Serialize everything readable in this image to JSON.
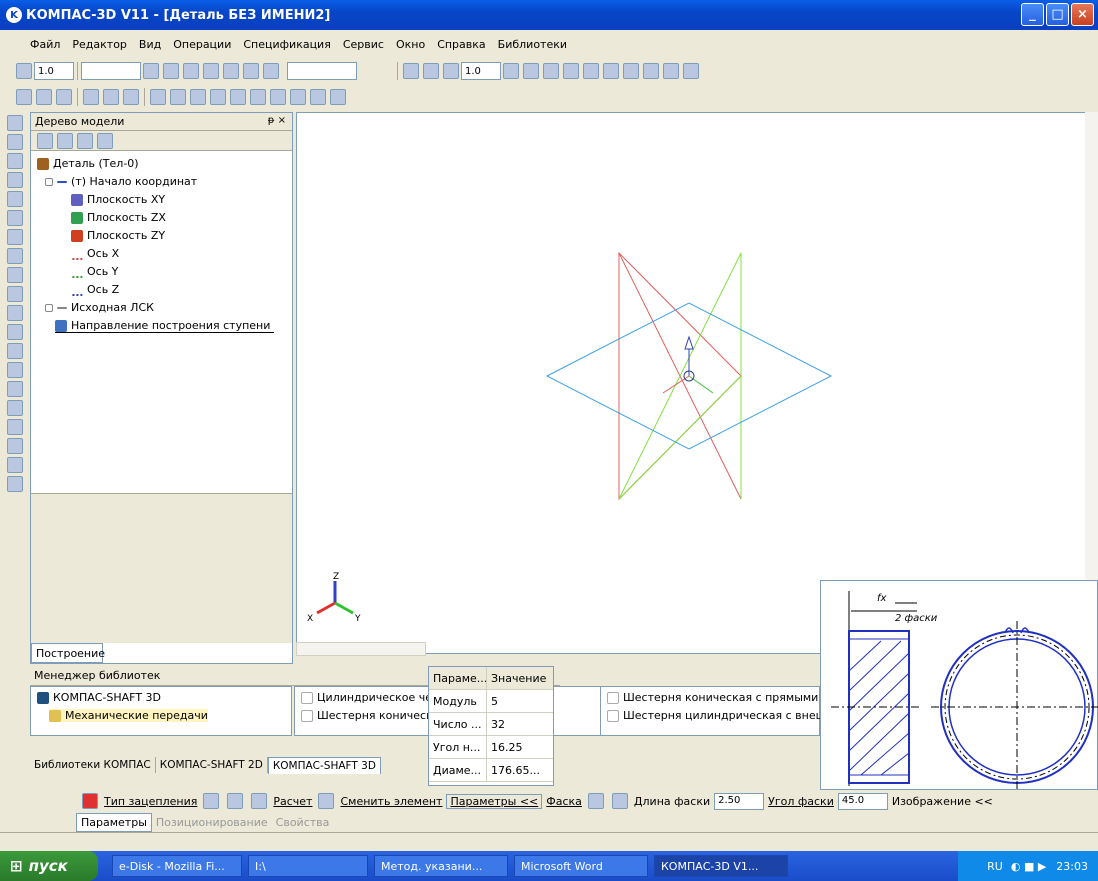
{
  "window": {
    "title": "КОМПАС-3D V11 - [Деталь БЕЗ ИМЕНИ2]"
  },
  "menu": [
    "Файл",
    "Редактор",
    "Вид",
    "Операции",
    "Спецификация",
    "Сервис",
    "Окно",
    "Справка",
    "Библиотеки"
  ],
  "toolbar": {
    "scale_left": "1.0",
    "scale_right": "1.0"
  },
  "tree": {
    "panel_title": "Дерево модели",
    "items": [
      "Деталь (Тел-0)",
      "(т) Начало координат",
      "Плоскость XY",
      "Плоскость ZX",
      "Плоскость ZY",
      "Ось X",
      "Ось Y",
      "Ось Z",
      "Исходная ЛСК",
      "Направление построения ступени"
    ],
    "tab": "Построение"
  },
  "library": {
    "title": "Менеджер библиотек",
    "list": [
      "КОМПАС-SHAFT 3D",
      "Механические передачи"
    ],
    "items_left": [
      "Цилиндрическое чер",
      "Шестерня коническа"
    ],
    "items_right": [
      "Шестерня коническая с прямыми з",
      "Шестерня цилиндрическая с внеш"
    ],
    "tabs": [
      "Библиотеки КОМПАС",
      "КОМПАС-SHAFT 2D",
      "КОМПАС-SHAFT 3D"
    ]
  },
  "params": {
    "header": [
      "Параме...",
      "Значение"
    ],
    "rows": [
      [
        "Модуль",
        "5"
      ],
      [
        "Число ...",
        "32"
      ],
      [
        "Угол н...",
        "16.25"
      ],
      [
        "Диаме...",
        "176.65..."
      ]
    ]
  },
  "preview": {
    "label_top": "fx",
    "label_bottom": "2 фаски"
  },
  "propbar": {
    "mesh": "Тип зацепления",
    "calc": "Расчет",
    "change": "Сменить элемент",
    "params": "Параметры <<",
    "chamfer": "Фаска",
    "chamfer_len_label": "Длина фаски",
    "chamfer_len": "2.50",
    "chamfer_angle_label": "Угол фаски",
    "chamfer_angle": "45.0",
    "image": "Изображение <<"
  },
  "proptabs": [
    "Параметры",
    "Позиционирование",
    "Свойства"
  ],
  "taskbar": {
    "start": "пуск",
    "tasks": [
      "e-Disk - Mozilla Fi...",
      "I:\\",
      "Метод. указани...",
      "Microsoft Word",
      "КОМПАС-3D V1..."
    ],
    "lang": "RU",
    "time": "23:03"
  },
  "axes": {
    "x": "X",
    "y": "Y",
    "z": "Z"
  }
}
